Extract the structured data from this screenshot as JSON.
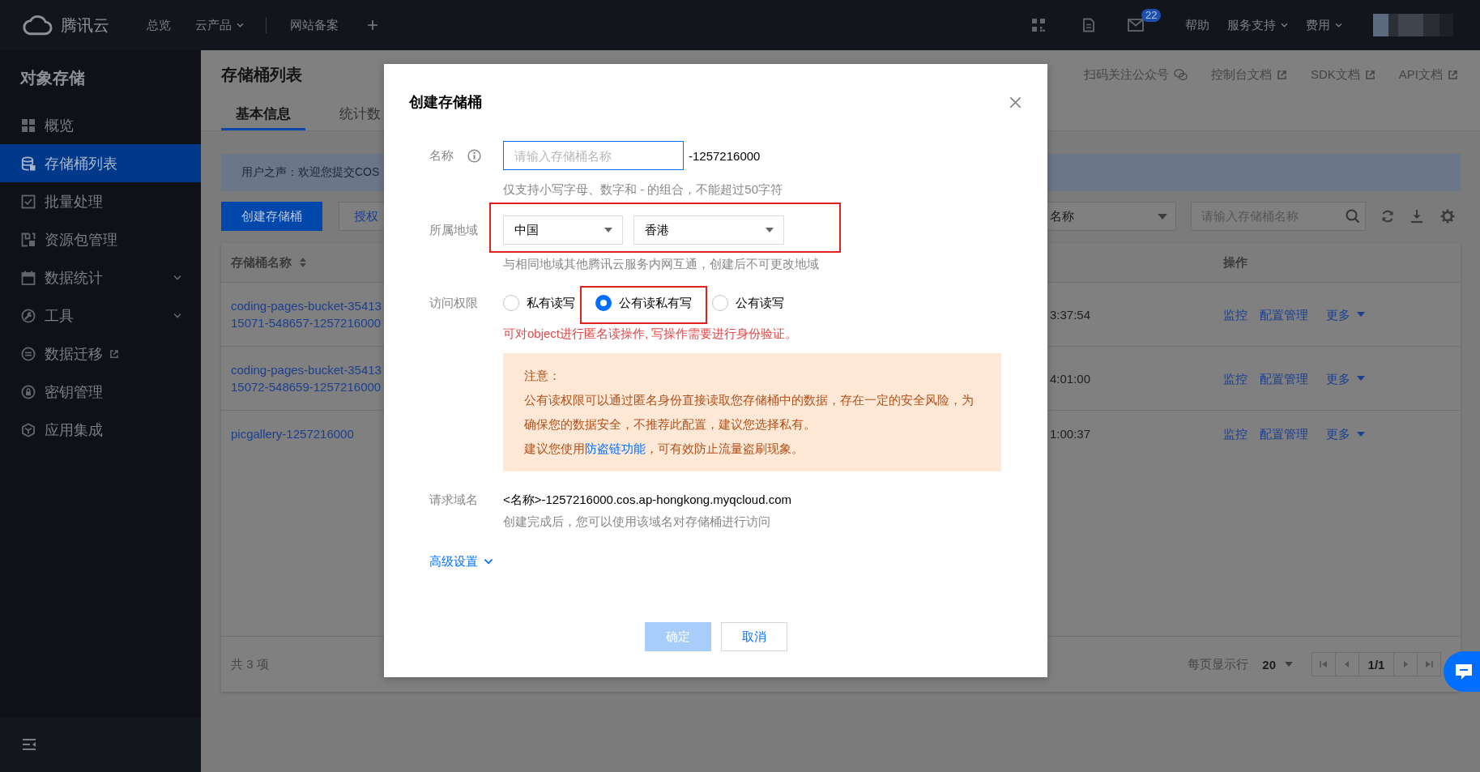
{
  "top_bar": {
    "logo": "腾讯云",
    "nav": [
      {
        "label": "总览",
        "has_menu": false,
        "divider_after": false
      },
      {
        "label": "云产品",
        "has_menu": true,
        "divider_after": true
      },
      {
        "label": "网站备案",
        "has_menu": false,
        "divider_after": false
      }
    ],
    "mail_badge": "22",
    "links": [
      {
        "label": "帮助",
        "has_menu": false
      },
      {
        "label": "服务支持",
        "has_menu": true
      },
      {
        "label": "费用",
        "has_menu": true
      }
    ]
  },
  "sidebar": {
    "title": "对象存储",
    "items": [
      {
        "label": "概览",
        "selected": false,
        "expandable": false,
        "external": false
      },
      {
        "label": "存储桶列表",
        "selected": true,
        "expandable": false,
        "external": false
      },
      {
        "label": "批量处理",
        "selected": false,
        "expandable": false,
        "external": false
      },
      {
        "label": "资源包管理",
        "selected": false,
        "expandable": false,
        "external": false
      },
      {
        "label": "数据统计",
        "selected": false,
        "expandable": true,
        "external": false
      },
      {
        "label": "工具",
        "selected": false,
        "expandable": true,
        "external": false
      },
      {
        "label": "数据迁移",
        "selected": false,
        "expandable": false,
        "external": true
      },
      {
        "label": "密钥管理",
        "selected": false,
        "expandable": false,
        "external": false
      },
      {
        "label": "应用集成",
        "selected": false,
        "expandable": false,
        "external": false
      }
    ]
  },
  "page": {
    "title": "存储桶列表",
    "links": [
      {
        "label": "扫码关注公众号",
        "kind": "social"
      },
      {
        "label": "控制台文档",
        "kind": "external"
      },
      {
        "label": "SDK文档",
        "kind": "external"
      },
      {
        "label": "API文档",
        "kind": "external"
      }
    ],
    "tabs": [
      {
        "label": "基本信息",
        "selected": true
      },
      {
        "label": "统计数",
        "selected": false
      }
    ],
    "notice": "用户之声：欢迎您提交COS",
    "toolbar": {
      "buttons": [
        {
          "label": "创建存储桶",
          "primary": true
        },
        {
          "label": "授权",
          "primary": false
        }
      ],
      "filter_value": "名称",
      "search_placeholder": "请输入存储桶名称"
    },
    "table": {
      "columns": [
        {
          "label": "存储桶名称",
          "sortable": true
        },
        {
          "label": "操作",
          "sortable": false
        }
      ],
      "rows": [
        {
          "name": "coding-pages-bucket-35413\n15071-548657-1257216000",
          "column_2": "3:37:54",
          "actions": [
            "监控",
            "配置管理"
          ],
          "more": "更多"
        },
        {
          "name": "coding-pages-bucket-35413\n15072-548659-1257216000",
          "column_2": "4:01:00",
          "actions": [
            "监控",
            "配置管理"
          ],
          "more": "更多"
        },
        {
          "name": "picgallery-1257216000",
          "column_2": "1:00:37",
          "actions": [
            "监控",
            "配置管理"
          ],
          "more": "更多"
        }
      ],
      "total": "共 3 项",
      "page_size_label": "每页显示行",
      "page_size": "20",
      "page": "1/1"
    }
  },
  "modal": {
    "title": "创建存储桶",
    "fields": [
      {
        "kind": "input",
        "label": "名称",
        "info": true,
        "placeholder": "请输入存储桶名称",
        "focused": true,
        "suffix": "-1257216000",
        "hint": "仅支持小写字母、数字和 - 的组合，不能超过50字符",
        "highlighted": false
      },
      {
        "kind": "select",
        "label": "所属地域",
        "selects": [
          {
            "value": "中国"
          },
          {
            "value": "香港"
          }
        ],
        "hint": "与相同地域其他腾讯云服务内网互通，创建后不可更改地域",
        "highlighted": true
      },
      {
        "kind": "radio",
        "label": "访问权限",
        "options": [
          {
            "label": "私有读写",
            "selected": false,
            "highlighted": false
          },
          {
            "label": "公有读私有写",
            "selected": true,
            "highlighted": true
          },
          {
            "label": "公有读写",
            "selected": false,
            "highlighted": false
          }
        ],
        "warning": "可对object进行匿名读操作, 写操作需要进行身份验证。",
        "notice": {
          "title": "注意：",
          "body": "公有读权限可以通过匿名身份直接读取您存储桶中的数据，存在一定的安全风险，为确保您的数据安全，不推荐此配置，建议您选择私有。",
          "advice_before": "建议您使用",
          "advice_link": "防盗链功能",
          "advice_after": "，可有效防止流量盗刷现象。"
        },
        "highlighted": false
      },
      {
        "kind": "text",
        "label": "请求域名",
        "value": "<名称>-1257216000.cos.ap-hongkong.myqcloud.com",
        "hint": "创建完成后，您可以使用该域名对存储桶进行访问",
        "highlighted": false
      }
    ],
    "advanced": {
      "label": "高级设置",
      "expanded": false
    },
    "buttons": [
      {
        "label": "确定",
        "primary": true,
        "disabled": true
      },
      {
        "label": "取消",
        "primary": false,
        "disabled": false
      }
    ]
  }
}
